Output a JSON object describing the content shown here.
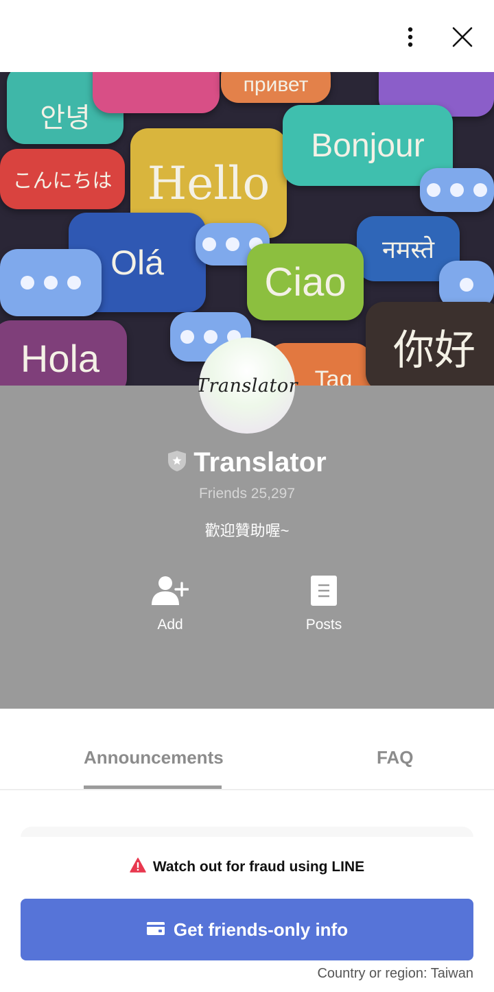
{
  "header": {
    "menu_icon": "more-vertical-icon",
    "close_icon": "close-icon"
  },
  "cover": {
    "greetings": [
      "안녕",
      "привет",
      "नमस्ते",
      "こんにちは",
      "Hello",
      "Bonjour",
      "Olá",
      "Ciao",
      "Hola",
      "你好",
      "Tag"
    ]
  },
  "profile": {
    "avatar_text": "Translator",
    "verified_icon": "shield-badge-icon",
    "name": "Translator",
    "friends": "Friends 25,297",
    "bio": "歡迎贊助喔~",
    "actions": [
      {
        "label": "Add",
        "icon": "add-friend-icon"
      },
      {
        "label": "Posts",
        "icon": "posts-icon"
      }
    ]
  },
  "tabs": [
    {
      "label": "Announcements",
      "active": true
    },
    {
      "label": "FAQ",
      "active": false
    }
  ],
  "fraud_warning": {
    "text": "Watch out for fraud using LINE",
    "icon": "warning-triangle-icon",
    "color": "#e8384f"
  },
  "cta": {
    "label": "Get friends-only info",
    "icon": "card-icon",
    "color": "#5674d8"
  },
  "region": "Country or region: Taiwan"
}
